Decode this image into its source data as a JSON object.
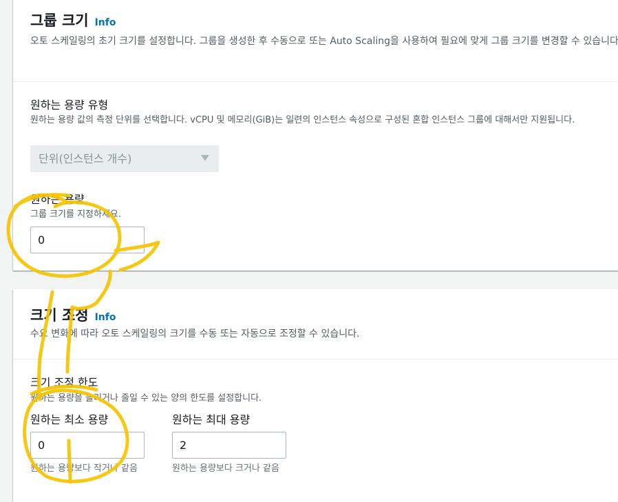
{
  "group_size": {
    "title": "그룹 크기",
    "info": "Info",
    "description": "오토 스케일링의 초기 크기를 설정합니다. 그룹을 생성한 후 수동으로 또는 Auto Scaling을 사용하여 필요에 맞게 그룹 크기를 변경할 수 있습니다.",
    "capacity_type": {
      "label": "원하는 용량 유형",
      "description": "원하는 용량 값의 측정 단위를 선택합니다. vCPU 및 메모리(GiB)는 일련의 인스턴스 속성으로 구성된 혼합 인스턴스 그룹에 대해서만 지원됩니다.",
      "selected": "단위(인스턴스 개수)"
    },
    "desired_capacity": {
      "label": "원하는 용량",
      "description": "그룹 크기를 지정하세요.",
      "value": "0"
    }
  },
  "scaling": {
    "title": "크기 조정",
    "info": "Info",
    "description": "수요 변화에 따라 오토 스케일링의 크기를 수동 또는 자동으로 조정할 수 있습니다.",
    "limits": {
      "label": "크기 조정 한도",
      "description": "원하는 용량을 늘리거나 줄일 수 있는 양의 한도를 설정합니다.",
      "min": {
        "label": "원하는 최소 용량",
        "value": "0",
        "constraint": "원하는 용량보다 작거나 같음"
      },
      "max": {
        "label": "원하는 최대 용량",
        "value": "2",
        "constraint": "원하는 용량보다 크거나 같음"
      }
    }
  },
  "colors": {
    "link": "#0073bb",
    "annotation": "#f5c400",
    "disabled_bg": "#eaeded"
  },
  "icons": {
    "select_arrow": "caret-down-icon"
  }
}
